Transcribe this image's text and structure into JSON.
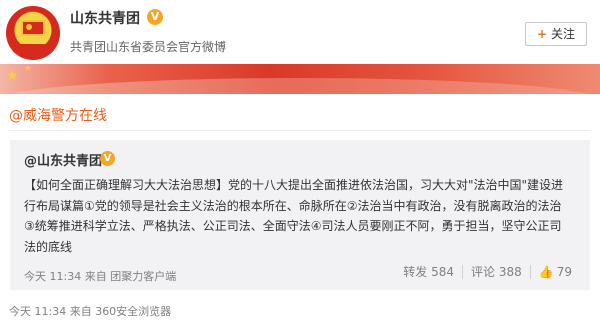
{
  "account": {
    "name": "山东共青团",
    "verified_badge": "V",
    "description": "共青团山东省委员会官方微博",
    "follow_label": "关注",
    "follow_icon": "plus-icon"
  },
  "banner": {
    "accent": "#d93a28"
  },
  "repost": {
    "user": "@威海警方在线"
  },
  "original": {
    "author": "@山东共青团",
    "verified_badge": "V",
    "lines": [
      "【如何全面正确理解习大大法治思想】党的十八大提出全面推进依法治国，习大大对\"法治中国\"建设进",
      "行布局谋篇①党的领导是社会主义法治的根本所在、命脉所在②法治当中有政治，没有脱离政治的法治",
      "③统筹推进科学立法、严格执法、公正司法、全面守法④司法人员要刚正不阿，勇于担当，坚守公正司",
      "法的底线"
    ],
    "meta": "今天 11:34 来自 团聚力客户端",
    "repost_label": "转发 584",
    "comment_label": "评论 388",
    "like_count": "79",
    "like_icon": "thumbs-up-icon"
  },
  "post": {
    "meta": "今天 11:34 来自 360安全浏览器"
  },
  "colors": {
    "link_orange": "#e8601a",
    "verified_gold": "#f5a623",
    "quote_bg": "#f2f2f5"
  }
}
